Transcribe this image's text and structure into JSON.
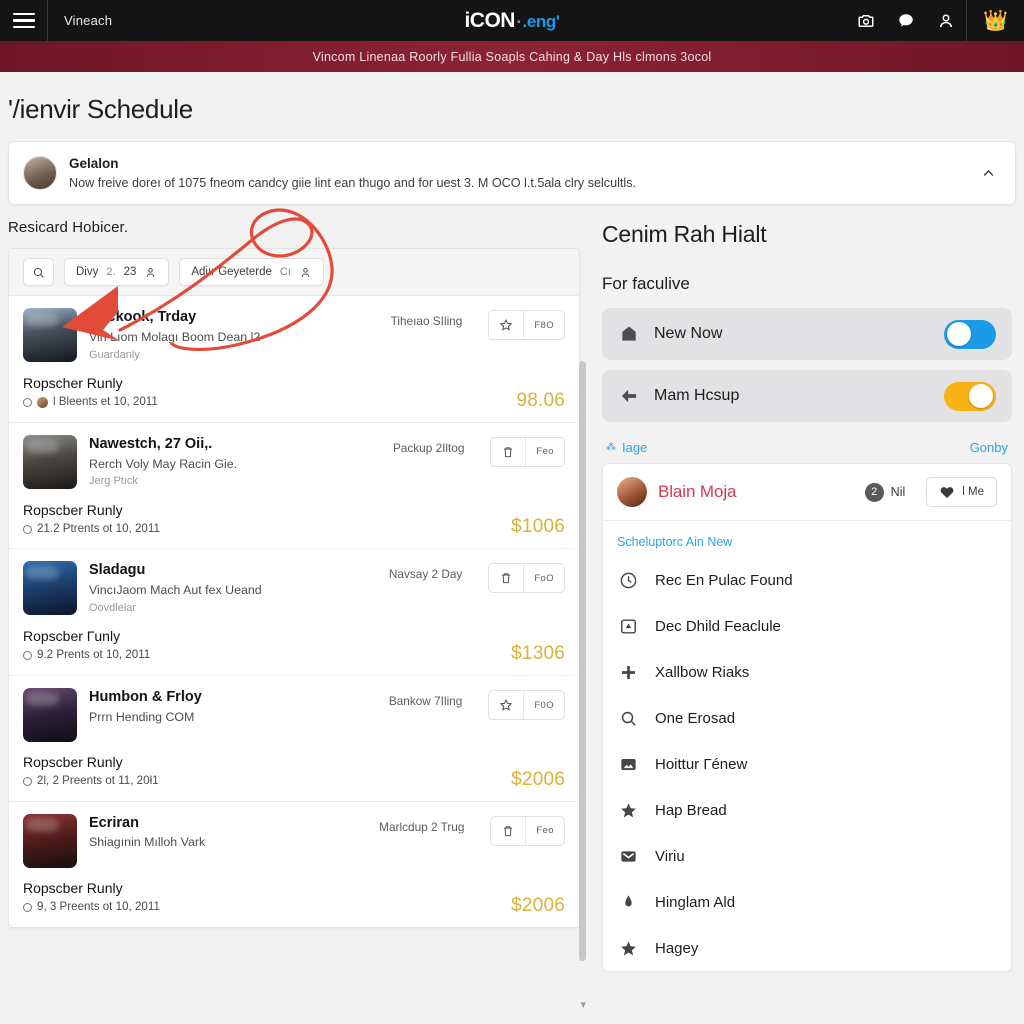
{
  "topbar": {
    "menu_icon": "hamburger-icon",
    "brand_word": "Vineach",
    "logo_main": "iCON",
    "logo_sup": "°",
    "logo_sub": ".eng'",
    "icons": [
      {
        "name": "camera-icon"
      },
      {
        "name": "chat-bubble-icon"
      },
      {
        "name": "account-person-icon"
      }
    ],
    "crown_emoji": "👑"
  },
  "banner": {
    "text": "Vincom Linenaa Roorly Fullia Soapls Cahing & Day Hls clmons 3ocol"
  },
  "page": {
    "title": "'/ienvir Schedule"
  },
  "notice": {
    "title": "Gelalon",
    "body": "Now freive doreı of 1075 fneom candcy giie lint ean thugo and for uest 3. M OCO l.t.5ala clry selcultls.",
    "collapse_icon": "chevron-up-icon"
  },
  "left": {
    "section_label": "Resicard Hobicer.",
    "toolbar": {
      "search_icon": "search-icon",
      "filter1_label": "Divy",
      "filter1_sep": "2.",
      "filter1_value": "23",
      "filter1_icon": "person-icon",
      "filter2_label": "Adiır Geyeterde",
      "filter2_sep": "Cı",
      "filter2_icon": "person-icon"
    },
    "rows": [
      {
        "name": "Heckook, Trday",
        "sub": "Vin Lıom Molagı Boom Dean l2",
        "sub2": "Guardanly",
        "meta": "Tiheıao SIling",
        "btn_icon": "star-icon",
        "btn_label": "F8O",
        "bottom_title": "Ropscher Runly",
        "bottom_sub": "l Bleents et 10, 2011",
        "price": "98.06",
        "thumb": "th1"
      },
      {
        "name": "Nawestch, 27 Oii,.",
        "sub": "Rerch Voly May Racin Gie.",
        "sub2": "Jerg Ptıck",
        "meta": "Packup 2Iltog",
        "btn_icon": "trash-icon",
        "btn_label": "Feo",
        "bottom_title": "Ropscber Runly",
        "bottom_sub": "21.2 Ptrents ot 10, 2011",
        "price": "$1006",
        "thumb": "th2"
      },
      {
        "name": "Sladagu",
        "sub": "VincıJaom Mach Aut fex Ueand",
        "sub2": "Oovdlelar",
        "meta": "Navsay 2 Day",
        "btn_icon": "trash-icon",
        "btn_label": "FoO",
        "bottom_title": "Ropscber Гunly",
        "bottom_sub": "9.2 Prents ot 10, 2011",
        "price": "$1306",
        "thumb": "th3"
      },
      {
        "name": "Humbon & Frloy",
        "sub": "Prrn Hending COM",
        "sub2": "",
        "meta": "Bankow 7Iling",
        "btn_icon": "star-icon",
        "btn_label": "F0O",
        "bottom_title": "Ropscber Runly",
        "bottom_sub": "2l, 2 Preents ot 11, 20ł1",
        "price": "$2006",
        "thumb": "th4"
      },
      {
        "name": "Ecriran",
        "sub": "Shiagınin Mılloh Vark",
        "sub2": "",
        "meta": "Marlcdup 2 Trug",
        "btn_icon": "trash-icon",
        "btn_label": "Feo",
        "bottom_title": "Ropscber Runly",
        "bottom_sub": "9, 3 Preents ot 10, 2011",
        "price": "$2006",
        "thumb": "th5"
      }
    ]
  },
  "right": {
    "title": "Cenim Rah Hialt",
    "sub_label": "For faculive",
    "toggles": [
      {
        "icon": "bookmark-icon",
        "label": "New Now",
        "state": "on",
        "color": "#1b9ae8"
      },
      {
        "icon": "arrow-left-icon",
        "label": "Mam Hcsup",
        "state": "on",
        "color": "#f5b315"
      }
    ],
    "link_row": {
      "pin_icon": "pin-icon",
      "left_label": "Iage",
      "right_label": "Gonby"
    },
    "card_head": {
      "avatar": "user-avatar",
      "name": "Blain Moja",
      "badge_count": "2",
      "badge_label": "Nil",
      "action_icon": "heart-icon",
      "action_label": "l Me"
    },
    "card_section": "Scheluptorc Ain New",
    "menu": [
      {
        "icon": "clock-icon",
        "label": "Rec En Pulac Found"
      },
      {
        "icon": "archive-icon",
        "label": "Dec Dhild Feaclule"
      },
      {
        "icon": "plus-icon",
        "label": "Xallbow Riaks"
      },
      {
        "icon": "search-icon",
        "label": "One Erosad"
      },
      {
        "icon": "image-icon",
        "label": "Hoittur Гénew"
      },
      {
        "icon": "star-icon",
        "label": "Hap Bread"
      },
      {
        "icon": "mail-icon",
        "label": "Viriu"
      },
      {
        "icon": "drop-icon",
        "label": "Hinglam Ald"
      },
      {
        "icon": "star-icon",
        "label": "Hagey"
      }
    ]
  },
  "annotation": {
    "color": "#e24a3a",
    "shape": "arrow-and-loop-circle"
  }
}
